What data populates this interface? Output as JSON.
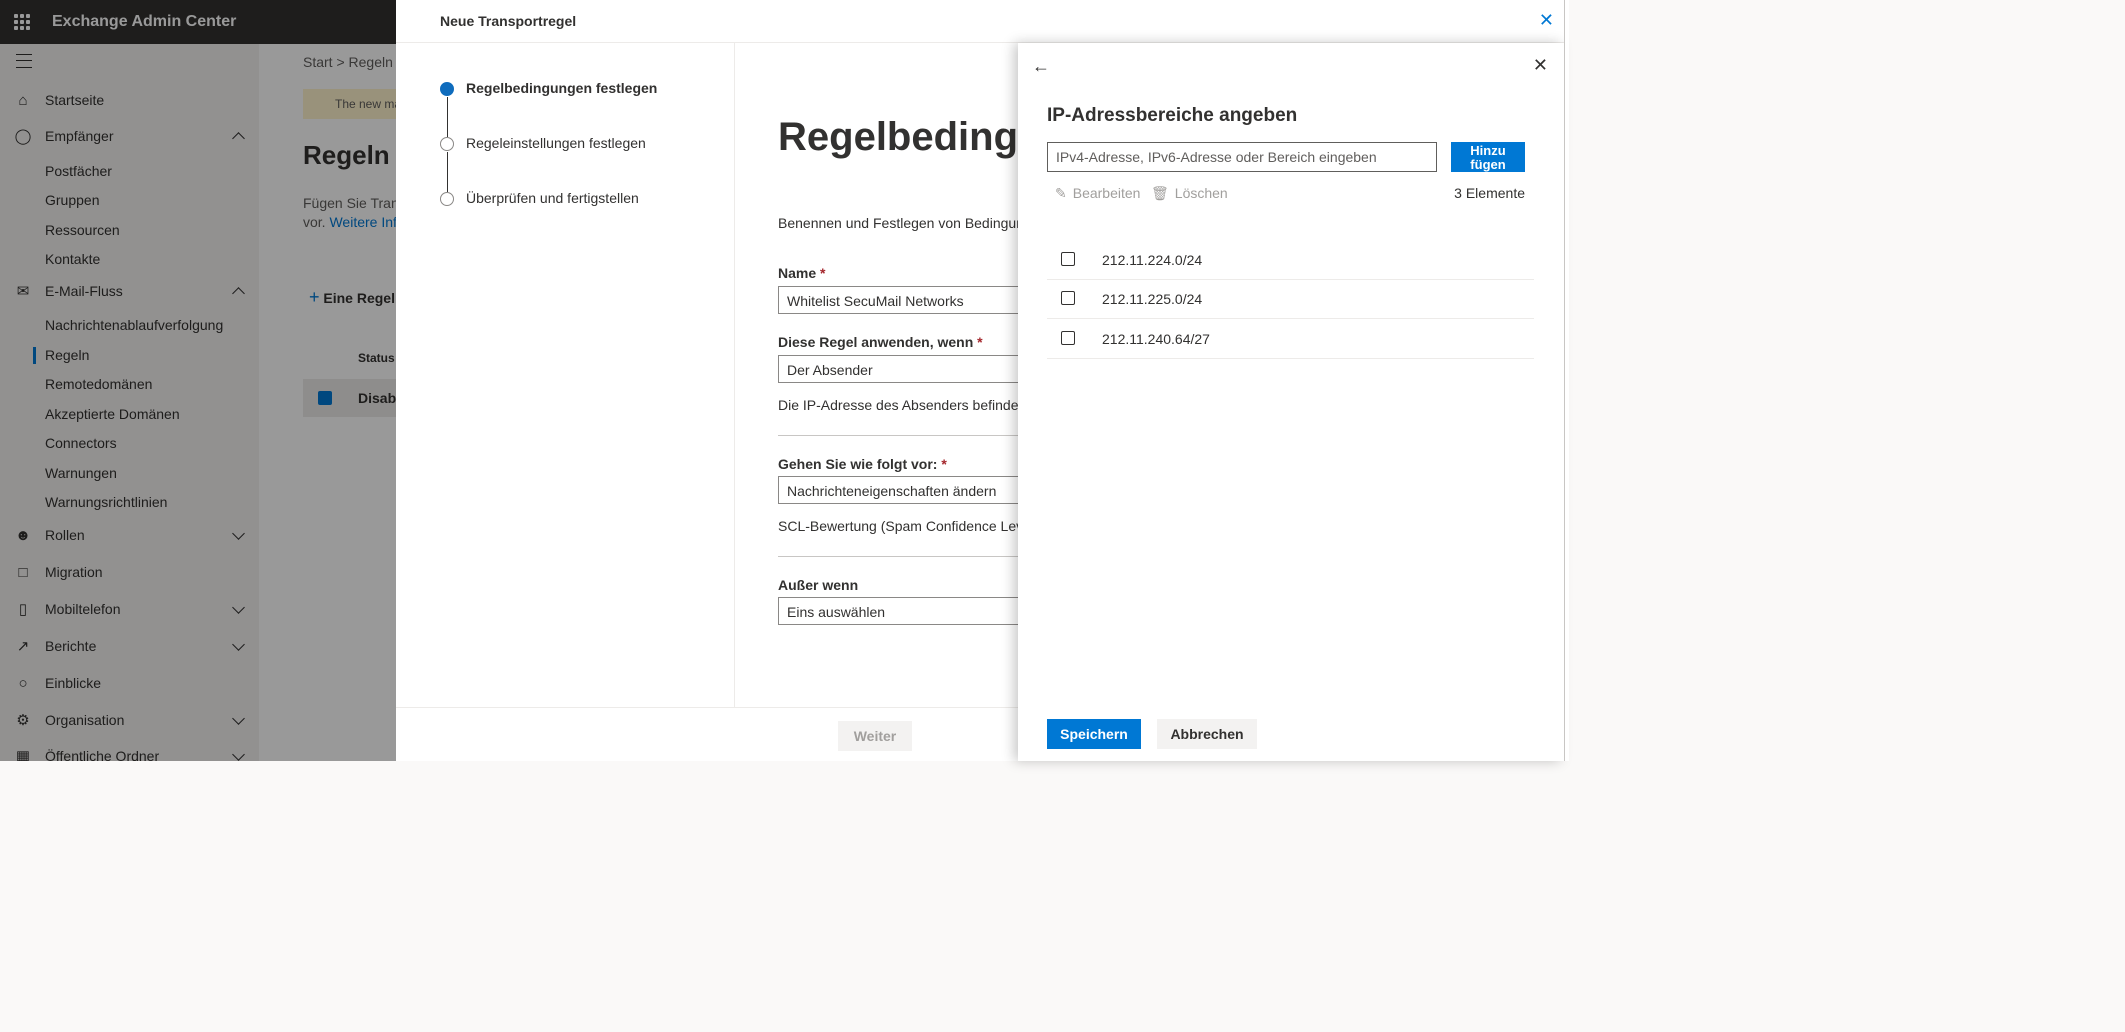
{
  "app": {
    "title": "Exchange Admin Center"
  },
  "nav": {
    "items": [
      {
        "label": "Startseite",
        "icon": "home-icon"
      },
      {
        "label": "Empfänger",
        "icon": "person-icon"
      },
      {
        "label": "E-Mail-Fluss",
        "icon": "mail-icon"
      },
      {
        "label": "Rollen",
        "icon": "roles-icon"
      },
      {
        "label": "Migration",
        "icon": "migration-icon"
      },
      {
        "label": "Mobiltelefon",
        "icon": "mobile-icon"
      },
      {
        "label": "Berichte",
        "icon": "chart-icon"
      },
      {
        "label": "Einblicke",
        "icon": "lightbulb-icon"
      },
      {
        "label": "Organisation",
        "icon": "org-icon"
      },
      {
        "label": "Öffentliche Ordner",
        "icon": "folder-icon"
      }
    ],
    "recipients_sub": [
      "Postfächer",
      "Gruppen",
      "Ressourcen",
      "Kontakte"
    ],
    "mailflow_sub": [
      "Nachrichtenablaufverfolgung",
      "Regeln",
      "Remotedomänen",
      "Akzeptierte Domänen",
      "Connectors",
      "Warnungen",
      "Warnungsrichtlinien"
    ]
  },
  "page": {
    "breadcrumb": "Start  >  Regeln",
    "info_text": "The new ma",
    "title": "Regeln",
    "desc": "Fügen Sie Transp",
    "desc2": "vor.",
    "more_link": "Weitere Info",
    "add_rule": "Eine Regel",
    "status_col": "Status",
    "row_status": "Disabl"
  },
  "panel": {
    "title": "Neue Transportregel",
    "steps": [
      "Regelbedingungen festlegen",
      "Regeleinstellungen festlegen",
      "Überprüfen und fertigstellen"
    ],
    "content_title": "Regelbedingu",
    "content_desc": "Benennen und Festlegen von Bedingungen",
    "name_label": "Name",
    "name_value": "Whitelist SecuMail Networks",
    "apply_label": "Diese Regel anwenden, wenn",
    "apply_value": "Der Absender",
    "apply_detail": "Die IP-Adresse des Absenders befindet sic",
    "action_label": "Gehen Sie wie folgt vor:",
    "action_value": "Nachrichteneigenschaften ändern",
    "action_detail": "SCL-Bewertung (Spam Confidence Level) f",
    "except_label": "Außer wenn",
    "except_value": "Eins auswählen",
    "required_mark": "*",
    "next_button": "Weiter"
  },
  "flyout": {
    "title": "IP-Adressbereiche angeben",
    "input_placeholder": "IPv4-Adresse, IPv6-Adresse oder Bereich eingeben",
    "add_button": "Hinzu fügen",
    "edit": "Bearbeiten",
    "delete": "Löschen",
    "count": "3 Elemente",
    "ip_ranges": [
      "212.11.224.0/24",
      "212.11.225.0/24",
      "212.11.240.64/27"
    ],
    "save": "Speichern",
    "cancel": "Abbrechen"
  }
}
